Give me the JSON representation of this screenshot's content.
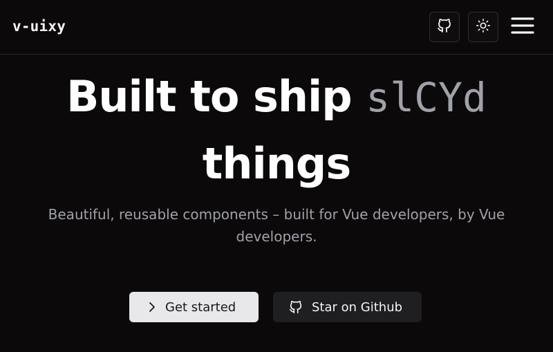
{
  "header": {
    "brand": "v-uixy",
    "github_icon": "github-icon",
    "theme_icon": "sun-icon",
    "menu_icon": "hamburger-menu-icon"
  },
  "hero": {
    "title_part1": "Built to ship",
    "title_scramble": "slCYd",
    "title_part2": "things",
    "subtitle": "Beautiful, reusable components – built for Vue developers, by Vue developers."
  },
  "actions": {
    "primary_label": "Get started",
    "primary_icon": "chevron-right-icon",
    "secondary_label": "Star on Github",
    "secondary_icon": "github-icon"
  },
  "colors": {
    "background": "#0b0909",
    "muted_text": "#a1a1aa",
    "primary_button_bg": "#e8e8ea",
    "secondary_button_bg": "#1f1f22"
  }
}
